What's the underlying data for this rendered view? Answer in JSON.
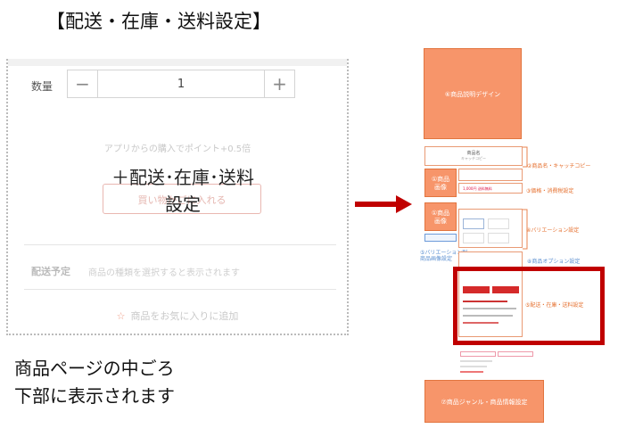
{
  "title": "【配送・在庫・送料設定】",
  "mock": {
    "quantity_label": "数量",
    "minus": "−",
    "plus": "+",
    "quantity_value": "1",
    "points_text": "アプリからの購入でポイント+0.5倍",
    "ghost_button": "買い物かごに入れる",
    "overlay_line1": "＋配送･在庫･送料",
    "overlay_line2": "設定",
    "shipping_label": "配送予定",
    "shipping_hint": "商品の種類を選択すると表示されます",
    "favorite_star": "☆",
    "favorite_text": "商品をお気に入りに追加"
  },
  "caption": {
    "line1": "商品ページの中ごろ",
    "line2": "下部に表示されます"
  },
  "thumb": {
    "top_block": "⑥商品説明デザイン",
    "product_name": "商品名",
    "catch_copy": "キャッチコピー",
    "price": "1,000円 送料無料",
    "label_name": "②商品名・キャッチコピー",
    "label_price": "③価格・消費税設定",
    "img1_line1": "①商品",
    "img1_line2": "画像",
    "img2_line1": "①商品",
    "img2_line2": "画像",
    "label_variation": "④バリエーション設定",
    "variation_image_label_1": "⑤バリエーション別",
    "variation_image_label_2": "商品画像設定",
    "label_option": "⑧商品オプション設定",
    "label_shipping": "⑤配送・在庫・送料設定",
    "bottom_block": "⑦商品ジャンル・商品情報設定"
  },
  "colors": {
    "accent_orange": "#f7956a",
    "highlight_red": "#c00000",
    "arrow_red": "#c00000"
  }
}
